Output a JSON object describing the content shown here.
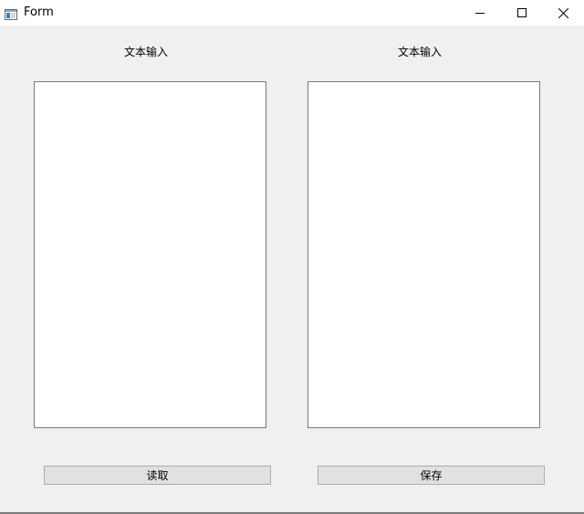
{
  "window": {
    "title": "Form"
  },
  "labels": {
    "left": "文本输入",
    "right": "文本输入"
  },
  "inputs": {
    "left_value": "",
    "right_value": ""
  },
  "buttons": {
    "read": "读取",
    "save": "保存"
  },
  "icons": {
    "app": "form-window-icon",
    "minimize": "minimize-icon",
    "maximize": "maximize-icon",
    "close": "close-icon"
  }
}
